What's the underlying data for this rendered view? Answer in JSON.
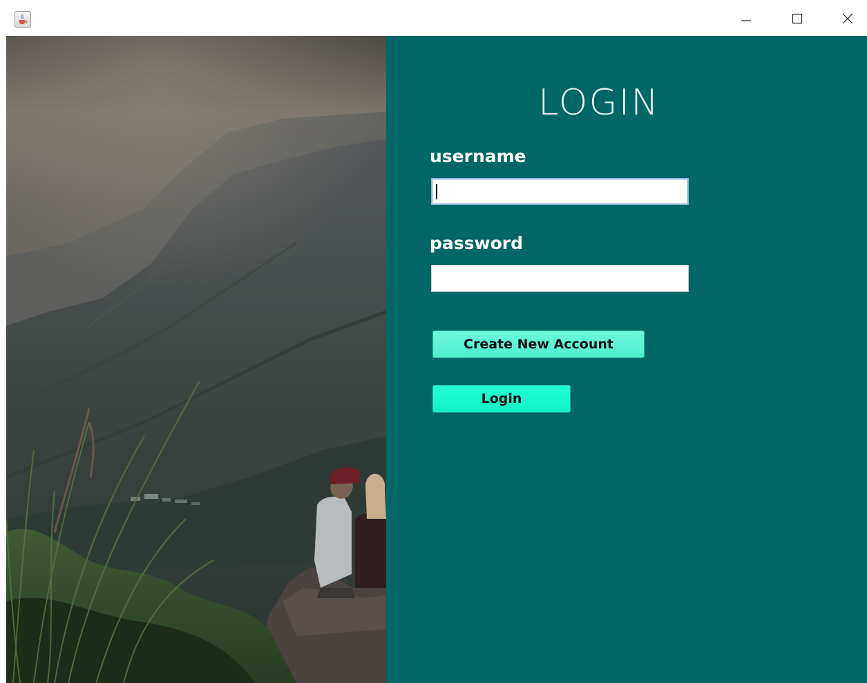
{
  "window": {
    "icons": {
      "app": "java-coffee-icon",
      "minimize": "minimize-icon",
      "maximize": "maximize-icon",
      "close": "close-icon"
    }
  },
  "login": {
    "title": "LOGIN",
    "username_label": "username",
    "username_value": "",
    "password_label": "password",
    "password_value": "",
    "create_account_label": "Create New Account",
    "login_label": "Login"
  },
  "colors": {
    "panel_bg": "#006666",
    "button_create": "#5ef4d6",
    "button_login": "#1af8d0"
  }
}
